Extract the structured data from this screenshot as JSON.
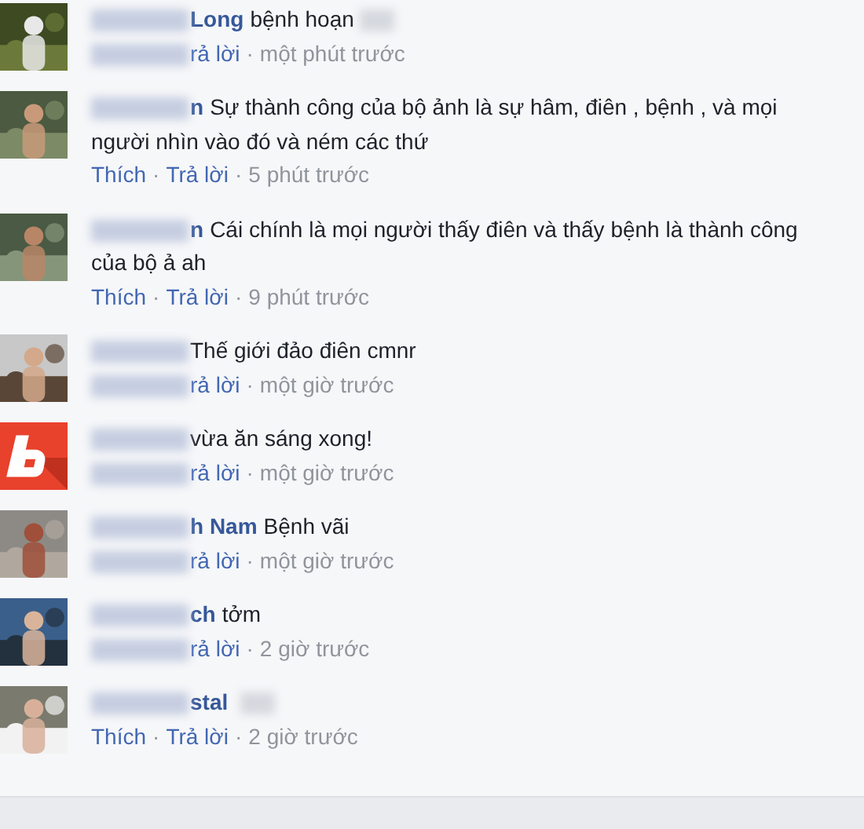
{
  "separator": "·",
  "comments": [
    {
      "blur_name": true,
      "name": "Long",
      "text": "bệnh hoạn",
      "blur_after": true,
      "blur_like": true,
      "reply": "rả lời",
      "time": "một phút trước"
    },
    {
      "blur_name": true,
      "name": "n",
      "text": "Sự thành công của bộ ảnh là sự hâm, điên , bệnh , và mọi người nhìn vào đó và ném các thứ",
      "blur_after": false,
      "blur_like": false,
      "like": "Thích",
      "reply": "Trả lời",
      "time": "5 phút trước"
    },
    {
      "blur_name": true,
      "name": "n",
      "text": "Cái chính là mọi người thấy điên và thấy bệnh là thành công của bộ ả ah",
      "blur_after": false,
      "blur_like": false,
      "like": "Thích",
      "reply": "Trả lời",
      "time": "9 phút trước"
    },
    {
      "blur_name": true,
      "text": "Thế giới đảo điên cmnr",
      "blur_after": false,
      "blur_like": true,
      "reply": "rả lời",
      "time": "một giờ trước"
    },
    {
      "avatar": {
        "kind": "logo"
      },
      "blur_name": true,
      "text": "vừa ăn sáng xong!",
      "blur_after": false,
      "blur_like": true,
      "reply": "rả lời",
      "time": "một giờ trước"
    },
    {
      "blur_name": true,
      "name": "h Nam",
      "text": "Bệnh vãi",
      "blur_after": false,
      "blur_like": true,
      "reply": "rả lời",
      "time": "một giờ trước"
    },
    {
      "blur_name": true,
      "name": "ch",
      "text": "tởm",
      "blur_after": false,
      "blur_like": true,
      "reply": "rả lời",
      "time": "2 giờ trước"
    },
    {
      "blur_name": true,
      "name": "stal",
      "blur_after": true,
      "blur_like": false,
      "like": "Thích",
      "reply": "Trả lời",
      "time": "2 giờ trước"
    }
  ]
}
